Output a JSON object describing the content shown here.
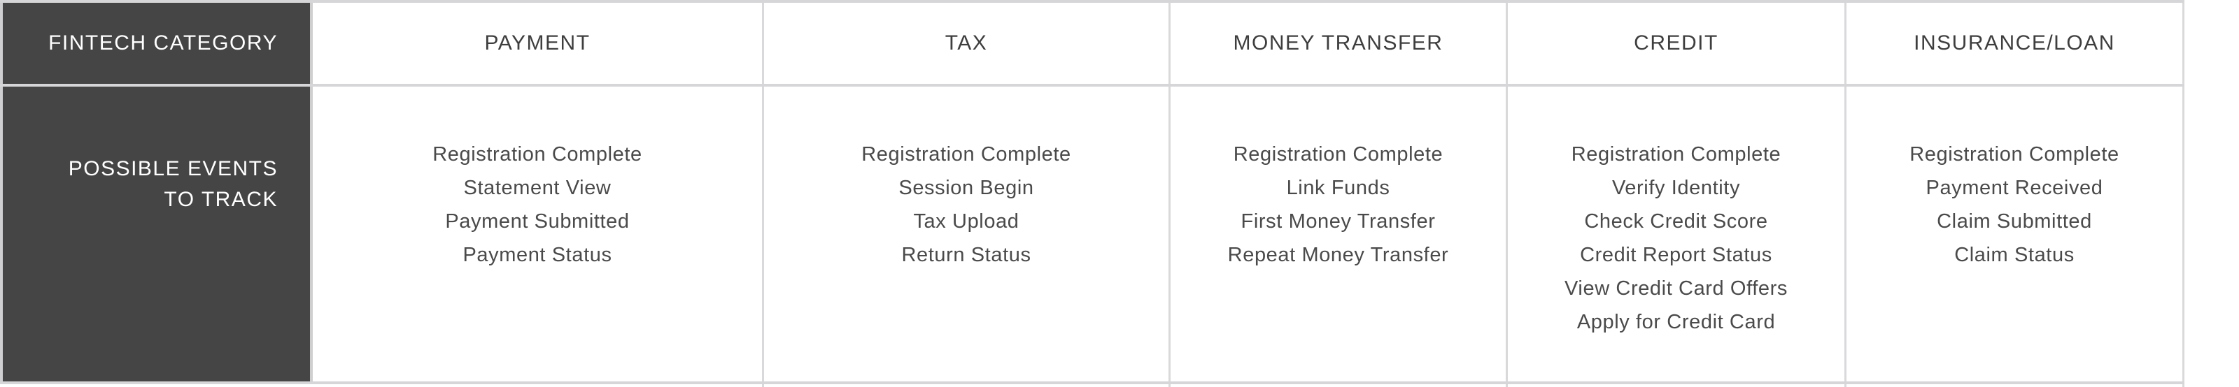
{
  "header": {
    "row_label": "FINTECH CATEGORY",
    "categories": [
      "PAYMENT",
      "TAX",
      "MONEY TRANSFER",
      "CREDIT",
      "INSURANCE/LOAN"
    ]
  },
  "body": {
    "row_label_line1": "POSSIBLE EVENTS",
    "row_label_line2": "TO TRACK",
    "events": [
      [
        "Registration Complete",
        "Statement View",
        "Payment Submitted",
        "Payment Status"
      ],
      [
        "Registration Complete",
        "Session Begin",
        "Tax Upload",
        "Return Status"
      ],
      [
        "Registration Complete",
        "Link Funds",
        "First Money Transfer",
        "Repeat Money Transfer"
      ],
      [
        "Registration Complete",
        "Verify Identity",
        "Check Credit Score",
        "Credit Report Status",
        "View Credit Card Offers",
        "Apply for Credit Card"
      ],
      [
        "Registration Complete",
        "Payment Received",
        "Claim Submitted",
        "Claim Status"
      ]
    ]
  },
  "colors": {
    "label_background": "#454545",
    "border": "#d6d6d8",
    "text": "#4a4a4a"
  }
}
